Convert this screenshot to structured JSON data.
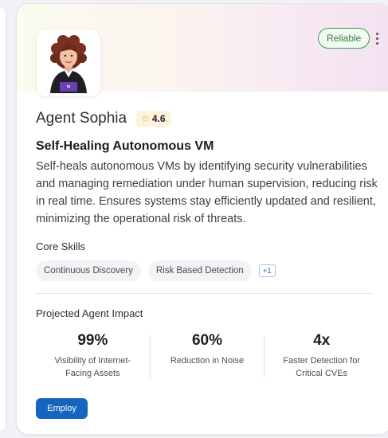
{
  "card": {
    "badge": "Reliable",
    "agent_name": "Agent Sophia",
    "rating": "4.6",
    "title": "Self-Healing Autonomous VM",
    "description": "Self-heals autonomous VMs by identifying security vulnerabilities and managing remediation under human supervision, reducing risk in real time. Ensures systems stay efficiently updated and resilient, minimizing the operational risk of threats.",
    "core_skills_label": "Core Skills",
    "skills": [
      "Continuous Discovery",
      "Risk Based Detection"
    ],
    "more_skills": "+1",
    "impact_label": "Projected Agent Impact",
    "metrics": [
      {
        "value": "99%",
        "label": "Visibility of Internet-Facing Assets"
      },
      {
        "value": "60%",
        "label": "Reduction in Noise"
      },
      {
        "value": "4x",
        "label": "Faster Detection for Critical CVEs"
      }
    ],
    "employ_label": "Employ"
  },
  "icons": {
    "rating": "star-icon",
    "menu": "kebab-menu-icon",
    "avatar": "agent-avatar"
  },
  "colors": {
    "accent": "#1565c0",
    "reliable_green": "#3f9a4f",
    "rating_bg": "#fdf3dc",
    "star": "#e0a21a"
  }
}
